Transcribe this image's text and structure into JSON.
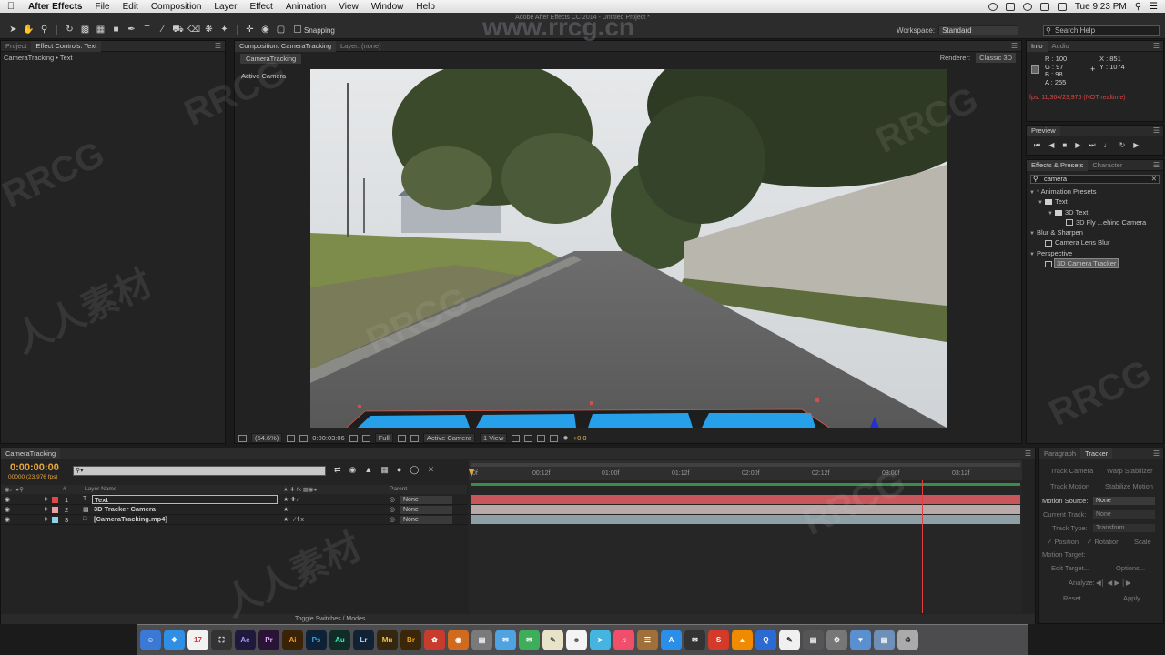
{
  "menubar": {
    "app_name": "After Effects",
    "items": [
      "File",
      "Edit",
      "Composition",
      "Layer",
      "Effect",
      "Animation",
      "View",
      "Window",
      "Help"
    ],
    "clock": "Tue 9:23 PM"
  },
  "window": {
    "title": "Adobe After Effects CC 2014 - Untitled Project *"
  },
  "toolbar": {
    "snapping_label": "Snapping",
    "workspace_label": "Workspace:",
    "workspace_value": "Standard",
    "search_placeholder": "Search Help"
  },
  "left_panel": {
    "tabs": [
      "Project",
      "Effect Controls: Text"
    ],
    "subtitle": "CameraTracking • Text"
  },
  "composition_panel": {
    "tabs": [
      "Composition: CameraTracking",
      "Layer: (none)"
    ],
    "comp_button": "CameraTracking",
    "renderer_label": "Renderer:",
    "renderer_value": "Classic 3D",
    "active_camera_label": "Active Camera",
    "viewer_bar": {
      "zoom": "(54.6%)",
      "timecode": "0:00:03:06",
      "resolution": "Full",
      "camera": "Active Camera",
      "views": "1 View",
      "exposure": "+0.0"
    }
  },
  "info_panel": {
    "tabs": [
      "Info",
      "Audio"
    ],
    "r": "R : 100",
    "g": "G : 97",
    "b": "B : 98",
    "a": "A : 255",
    "x": "X : 851",
    "y": "Y : 1074",
    "fps": "fps: 11,364/23,976 (NOT realtime)",
    "swatch_color": "#646462"
  },
  "preview_panel": {
    "tabs": [
      "Preview"
    ]
  },
  "effects_panel": {
    "tabs": [
      "Effects & Presets",
      "Character"
    ],
    "search_value": "camera",
    "tree": [
      {
        "label": "* Animation Presets",
        "indent": 0,
        "kind": "group"
      },
      {
        "label": "Text",
        "indent": 1,
        "kind": "folder"
      },
      {
        "label": "3D Text",
        "indent": 2,
        "kind": "folder"
      },
      {
        "label": "3D Fly ...ehind Camera",
        "indent": 3,
        "kind": "preset"
      },
      {
        "label": "Blur & Sharpen",
        "indent": 0,
        "kind": "group"
      },
      {
        "label": "Camera Lens Blur",
        "indent": 1,
        "kind": "effect"
      },
      {
        "label": "Perspective",
        "indent": 0,
        "kind": "group"
      },
      {
        "label": "3D Camera Tracker",
        "indent": 1,
        "kind": "effect",
        "selected": true
      }
    ]
  },
  "timeline": {
    "tab": "CameraTracking",
    "timecode": "0:00:00:00",
    "fps_label": "00000 (23.976 fps)",
    "search_value": "",
    "columns": {
      "layer_name": "Layer Name",
      "parent": "Parent"
    },
    "ruler_labels": [
      "0f",
      "00:12f",
      "01:00f",
      "01:12f",
      "02:00f",
      "02:12f",
      "03:00f",
      "03:12f"
    ],
    "layers": [
      {
        "num": "1",
        "type": "T",
        "name": "Text",
        "parent": "None",
        "color": "#e04848",
        "bar_color": "#c9565a"
      },
      {
        "num": "2",
        "type": "cam",
        "name": "3D Tracker Camera",
        "parent": "None",
        "color": "#e6a2a2",
        "bar_color": "#b9a9a9"
      },
      {
        "num": "3",
        "type": "footage",
        "name": "[CameraTracking.mp4]",
        "parent": "None",
        "color": "#8ed2e8",
        "bar_color": "#8f9fa6"
      }
    ],
    "footer_label": "Toggle Switches / Modes"
  },
  "tracker_panel": {
    "tabs": [
      "Paragraph",
      "Tracker"
    ],
    "track_camera": "Track Camera",
    "warp_stabilizer": "Warp Stabilizer",
    "track_motion": "Track Motion",
    "stabilize_motion": "Stabilize Motion",
    "motion_source_label": "Motion Source:",
    "motion_source_value": "None",
    "current_track_label": "Current Track:",
    "current_track_value": "None",
    "track_type_label": "Track Type:",
    "track_type_value": "Transform",
    "position": "Position",
    "rotation": "Rotation",
    "scale": "Scale",
    "motion_target": "Motion Target:",
    "edit_target": "Edit Target...",
    "options": "Options...",
    "analyze": "Analyze:",
    "reset": "Reset",
    "apply": "Apply"
  },
  "watermarks": {
    "site": "www.rrcg.cn",
    "brand": "RRCG",
    "cn": "人人素材"
  },
  "dock": {
    "apps": [
      {
        "label": "Ae",
        "color": "#1f1a3b",
        "text_color": "#a49cff"
      },
      {
        "label": "Pr",
        "color": "#2a1436",
        "text_color": "#e8a5ff"
      },
      {
        "label": "Ai",
        "color": "#3a2206",
        "text_color": "#ff9a1c"
      },
      {
        "label": "Ps",
        "color": "#0d2236",
        "text_color": "#31a8ff"
      },
      {
        "label": "Au",
        "color": "#102c26",
        "text_color": "#3ee8c0"
      },
      {
        "label": "Lr",
        "color": "#122235",
        "text_color": "#add5ec"
      },
      {
        "label": "Mu",
        "color": "#352610",
        "text_color": "#f5c542"
      },
      {
        "label": "Br",
        "color": "#3a2608",
        "text_color": "#f4a31b"
      }
    ]
  }
}
